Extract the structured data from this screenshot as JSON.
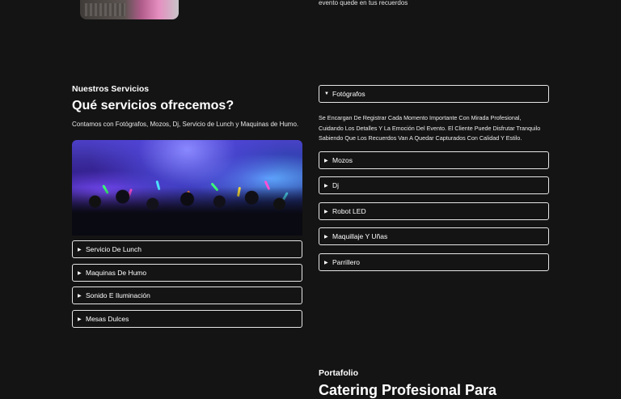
{
  "top": {
    "caption": "evento quede en tus recuerdos"
  },
  "services": {
    "kicker": "Nuestros Servicios",
    "heading": "Qué servicios ofrecemos?",
    "intro": "Contamos con Fotógrafos, Mozos, Dj, Servicio de Lunch y Maquinas de Humo.",
    "left_items": [
      {
        "label": "Servicio De Lunch"
      },
      {
        "label": "Maquinas De Humo"
      },
      {
        "label": "Sonido E Iluminación"
      },
      {
        "label": "Mesas Dulces"
      }
    ],
    "right_items": [
      {
        "label": "Fotógrafos",
        "expanded": true
      },
      {
        "label": "Mozos"
      },
      {
        "label": "Dj"
      },
      {
        "label": "Robot LED"
      },
      {
        "label": "Maquillaje Y Uñas"
      },
      {
        "label": "Parrillero"
      }
    ],
    "expanded_text_lines": [
      "Se Encargan De Registrar Cada Momento Importante Con Mirada Profesional,",
      "Cuidando Los Detalles Y La Emoción Del Evento. El Cliente Puede Disfrutar Tranquilo",
      "Sabiendo Que Los Recuerdos Van A Quedar Capturados Con Calidad Y Estilo."
    ]
  },
  "portfolio": {
    "kicker": "Portafolio",
    "heading": "Catering Profesional Para"
  },
  "icons": {
    "collapsed": "▶",
    "expanded": "▼"
  },
  "colors": {
    "background": "#141414",
    "text": "#ffffff",
    "border": "#e6e6e6"
  }
}
